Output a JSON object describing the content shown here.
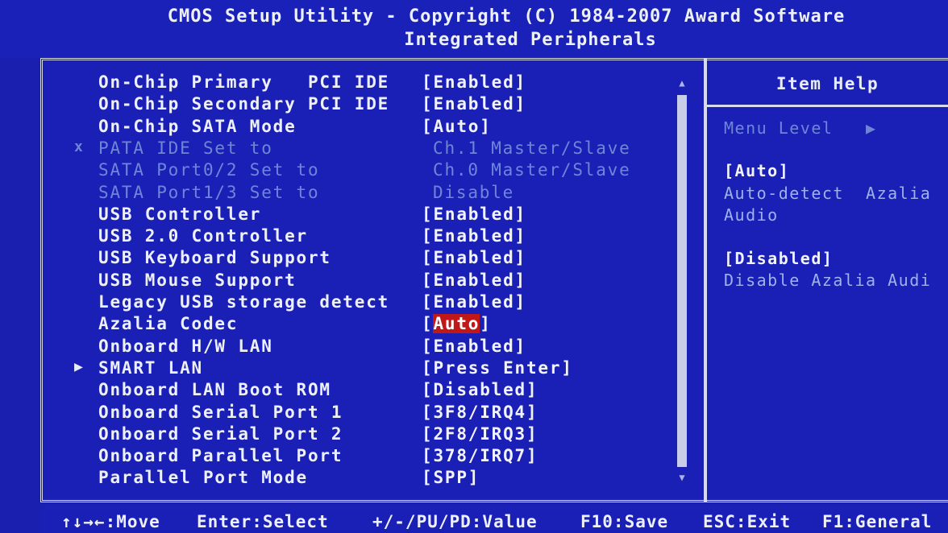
{
  "header": {
    "title": "CMOS Setup Utility - Copyright (C) 1984-2007 Award Software",
    "subtitle": "Integrated Peripherals"
  },
  "settings": [
    {
      "label": "On-Chip Primary   PCI IDE",
      "value": "[Enabled]",
      "state": "normal",
      "marker": ""
    },
    {
      "label": "On-Chip Secondary PCI IDE",
      "value": "[Enabled]",
      "state": "normal",
      "marker": ""
    },
    {
      "label": "On-Chip SATA Mode",
      "value": "[Auto]",
      "state": "normal",
      "marker": ""
    },
    {
      "label": "PATA IDE Set to",
      "value": "Ch.1 Master/Slave",
      "state": "disabled",
      "marker": "x"
    },
    {
      "label": "SATA Port0/2 Set to",
      "value": "Ch.0 Master/Slave",
      "state": "disabled",
      "marker": ""
    },
    {
      "label": "SATA Port1/3 Set to",
      "value": "Disable",
      "state": "disabled",
      "marker": ""
    },
    {
      "label": "USB Controller",
      "value": "[Enabled]",
      "state": "normal",
      "marker": ""
    },
    {
      "label": "USB 2.0 Controller",
      "value": "[Enabled]",
      "state": "normal",
      "marker": ""
    },
    {
      "label": "USB Keyboard Support",
      "value": "[Enabled]",
      "state": "normal",
      "marker": ""
    },
    {
      "label": "USB Mouse Support",
      "value": "[Enabled]",
      "state": "normal",
      "marker": ""
    },
    {
      "label": "Legacy USB storage detect",
      "value": "[Enabled]",
      "state": "normal",
      "marker": ""
    },
    {
      "label": "Azalia Codec",
      "value": "Auto",
      "state": "selected",
      "marker": ""
    },
    {
      "label": "Onboard H/W LAN",
      "value": "[Enabled]",
      "state": "normal",
      "marker": ""
    },
    {
      "label": "SMART LAN",
      "value": "[Press Enter]",
      "state": "normal",
      "marker": "▶"
    },
    {
      "label": "Onboard LAN Boot ROM",
      "value": "[Disabled]",
      "state": "normal",
      "marker": ""
    },
    {
      "label": "Onboard Serial Port 1",
      "value": "[3F8/IRQ4]",
      "state": "normal",
      "marker": ""
    },
    {
      "label": "Onboard Serial Port 2",
      "value": "[2F8/IRQ3]",
      "state": "normal",
      "marker": ""
    },
    {
      "label": "Onboard Parallel Port",
      "value": "[378/IRQ7]",
      "state": "normal",
      "marker": ""
    },
    {
      "label": "Parallel Port Mode",
      "value": "[SPP]",
      "state": "normal",
      "marker": ""
    }
  ],
  "help": {
    "title": "Item Help",
    "menu_level": "Menu Level   ▶",
    "opt1_value": "[Auto]",
    "opt1_desc_1": "Auto-detect  Azalia",
    "opt1_desc_2": "Audio",
    "opt2_value": "[Disabled]",
    "opt2_desc": "Disable Azalia Audi"
  },
  "hotkeys": {
    "move": "↑↓→←:Move",
    "select": "Enter:Select",
    "value": "+/-/PU/PD:Value",
    "save": "F10:Save",
    "exit": "ESC:Exit",
    "general": "F1:General"
  },
  "colors": {
    "background": "#1a20b6",
    "text": "#eef0f8",
    "disabled_text": "#6f86d8",
    "highlight": "#c01818"
  }
}
